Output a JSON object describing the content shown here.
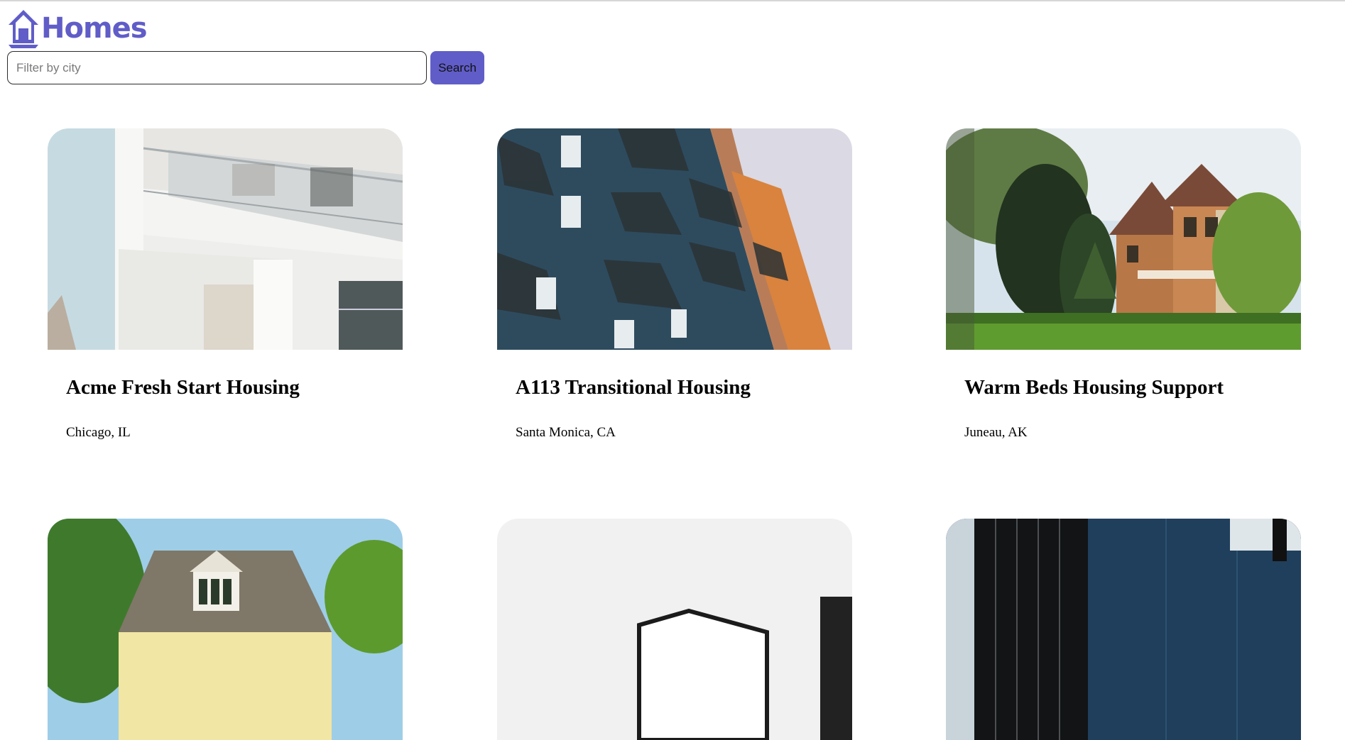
{
  "header": {
    "brand": "Homes",
    "logo_icon": "house-icon",
    "brand_color": "#605dc8"
  },
  "search": {
    "placeholder": "Filter by city",
    "value": "",
    "button_label": "Search"
  },
  "listings": [
    {
      "name": "Acme Fresh Start Housing",
      "location": "Chicago, IL",
      "photo": "white-apartment-balcony-photo"
    },
    {
      "name": "A113 Transitional Housing",
      "location": "Santa Monica, CA",
      "photo": "blue-orange-apartment-photo"
    },
    {
      "name": "Warm Beds Housing Support",
      "location": "Juneau, AK",
      "photo": "victorian-house-photo"
    },
    {
      "name": "",
      "location": "",
      "photo": "yellow-house-photo"
    },
    {
      "name": "",
      "location": "",
      "photo": "white-modern-house-photo"
    },
    {
      "name": "",
      "location": "",
      "photo": "dark-modern-building-photo"
    }
  ]
}
